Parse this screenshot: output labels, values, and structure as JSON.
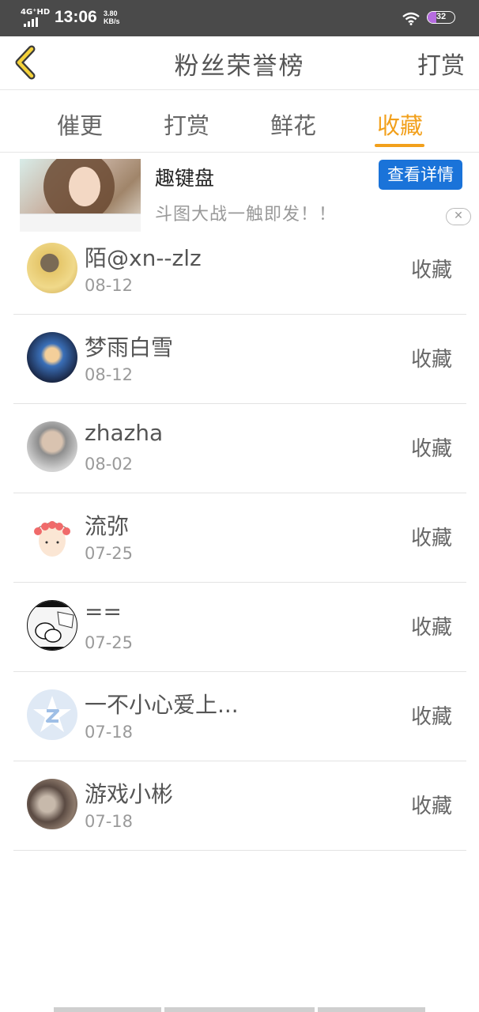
{
  "status_bar": {
    "network": "4G⁺HD",
    "time": "13:06",
    "speed_value": "3.80",
    "speed_unit": "KB/s",
    "battery": "32"
  },
  "header": {
    "title": "粉丝荣誉榜",
    "right_action": "打赏",
    "back_icon": "chevron-left-icon",
    "accent_color": "#f2a01c"
  },
  "tabs": [
    {
      "label": "催更",
      "active": false
    },
    {
      "label": "打赏",
      "active": false
    },
    {
      "label": "鲜花",
      "active": false
    },
    {
      "label": "收藏",
      "active": true
    }
  ],
  "ad": {
    "title": "趣键盘",
    "subtitle": "斗图大战一触即发！！",
    "button": "查看详情",
    "close_icon": "close-icon"
  },
  "fans": [
    {
      "name": "陌@xn--zlz",
      "date": "08-12",
      "action": "收藏"
    },
    {
      "name": "梦雨白雪",
      "date": "08-12",
      "action": "收藏"
    },
    {
      "name": "zhazha",
      "date": "08-02",
      "action": "收藏"
    },
    {
      "name": "流弥",
      "date": "07-25",
      "action": "收藏"
    },
    {
      "name": "==",
      "date": "07-25",
      "action": "收藏"
    },
    {
      "name": "一不小心爱上...",
      "date": "07-18",
      "action": "收藏"
    },
    {
      "name": "游戏小彬",
      "date": "07-18",
      "action": "收藏"
    }
  ]
}
